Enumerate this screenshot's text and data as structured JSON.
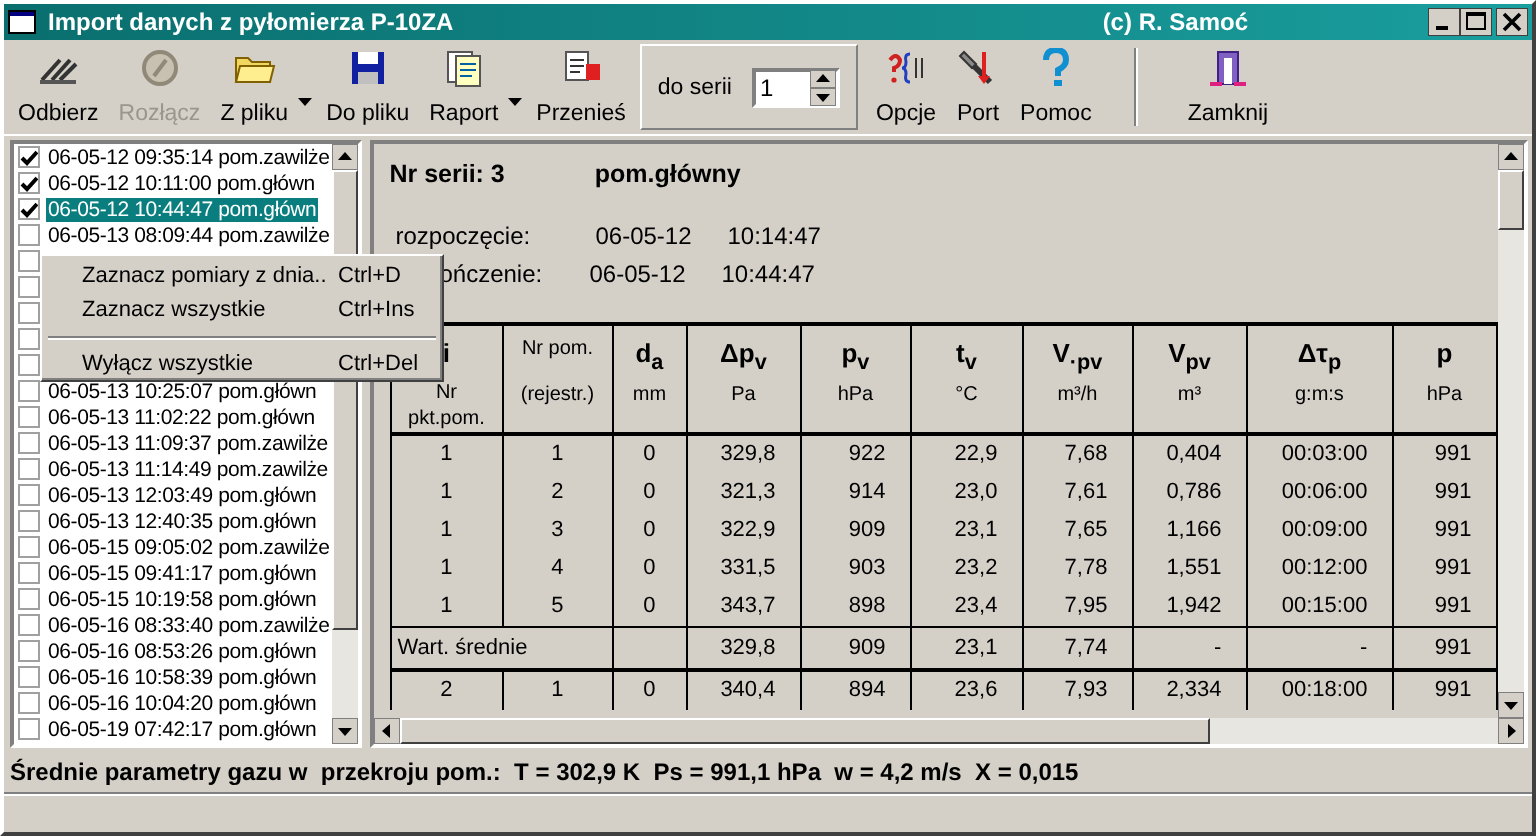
{
  "window": {
    "title": "Import danych z pyłomierza P-10ZA",
    "author": "(c) R. Samoć"
  },
  "toolbar": [
    {
      "label": "Odbierz",
      "disabled": false,
      "dropdown": false
    },
    {
      "label": "Rozłącz",
      "disabled": true,
      "dropdown": false
    },
    {
      "label": "Z pliku",
      "disabled": false,
      "dropdown": true
    },
    {
      "label": "Do pliku",
      "disabled": false,
      "dropdown": false
    },
    {
      "label": "Raport",
      "disabled": false,
      "dropdown": true
    },
    {
      "label": "Przenieś",
      "disabled": false,
      "dropdown": false
    }
  ],
  "series_selector": {
    "label": "do serii",
    "value": "1"
  },
  "toolbar_right": [
    {
      "label": "Opcje"
    },
    {
      "label": "Port"
    },
    {
      "label": "Pomoc"
    }
  ],
  "close_button": {
    "label": "Zamknij"
  },
  "measurements": [
    {
      "text": "06-05-12 09:35:14 pom.zawilże",
      "checked": true,
      "selected": false
    },
    {
      "text": "06-05-12 10:11:00 pom.główn",
      "checked": true,
      "selected": false
    },
    {
      "text": "06-05-12 10:44:47 pom.główn",
      "checked": true,
      "selected": true
    },
    {
      "text": "06-05-13 08:09:44 pom.zawilże",
      "checked": false,
      "selected": false
    },
    {
      "checked": false
    },
    {
      "checked": false
    },
    {
      "checked": false
    },
    {
      "checked": false
    },
    {
      "checked": false
    },
    {
      "text": "06-05-13 10:25:07 pom.główn",
      "checked": false,
      "selected": false
    },
    {
      "text": "06-05-13 11:02:22 pom.główn",
      "checked": false,
      "selected": false
    },
    {
      "text": "06-05-13 11:09:37 pom.zawilże",
      "checked": false,
      "selected": false
    },
    {
      "text": "06-05-13 11:14:49 pom.zawilże",
      "checked": false,
      "selected": false
    },
    {
      "text": "06-05-13 12:03:49 pom.główn",
      "checked": false,
      "selected": false
    },
    {
      "text": "06-05-13 12:40:35 pom.główn",
      "checked": false,
      "selected": false
    },
    {
      "text": "06-05-15 09:05:02 pom.zawilże",
      "checked": false,
      "selected": false
    },
    {
      "text": "06-05-15 09:41:17 pom.główn",
      "checked": false,
      "selected": false
    },
    {
      "text": "06-05-15 10:19:58 pom.główn",
      "checked": false,
      "selected": false
    },
    {
      "text": "06-05-16 08:33:40 pom.zawilże",
      "checked": false,
      "selected": false
    },
    {
      "text": "06-05-16 08:53:26 pom.główn",
      "checked": false,
      "selected": false
    },
    {
      "text": "06-05-16 10:58:39 pom.główn",
      "checked": false,
      "selected": false
    },
    {
      "text": "06-05-16 10:04:20 pom.główn",
      "checked": false,
      "selected": false
    },
    {
      "text": "06-05-19 07:42:17 pom.główn",
      "checked": false,
      "selected": false
    }
  ],
  "context_menu": [
    {
      "kind": "item",
      "label": "Zaznacz pomiary z dnia..",
      "shortcut": "Ctrl+D"
    },
    {
      "kind": "item",
      "label": "Zaznacz wszystkie",
      "shortcut": "Ctrl+Ins"
    },
    {
      "kind": "separator"
    },
    {
      "kind": "item",
      "label": "Wyłącz wszystkie",
      "shortcut": "Ctrl+Del"
    }
  ],
  "series": {
    "number": "Nr serii: 3",
    "place": "pom.główny",
    "start_label": "rozpoczęcie:",
    "start_date": "06-05-12",
    "start_time": "10:14:47",
    "end_label": "ończenie:",
    "end_date": "06-05-12",
    "end_time": "10:44:47"
  },
  "table": {
    "columns": [
      {
        "symbol": "i",
        "unit": "Nr pkt.pom."
      },
      {
        "symbol": "Nr pom.",
        "unit": "(rejestr.)",
        "kind": "plain"
      },
      {
        "symbol": "d$_{a}$",
        "unit": "mm"
      },
      {
        "symbol": "Δp$_{v}$",
        "unit": "Pa"
      },
      {
        "symbol": "p$_{v}$",
        "unit": "hPa"
      },
      {
        "symbol": "t$_{v}$",
        "unit": "°C"
      },
      {
        "symbol": "V$_{·pv}$",
        "unit": "m³/h"
      },
      {
        "symbol": "V$_{pv}$",
        "unit": "m³"
      },
      {
        "symbol": "Δτ$_{p}$",
        "unit": "g:m:s"
      },
      {
        "symbol": "p",
        "unit": "hPa"
      }
    ],
    "rows": [
      {
        "kind": "data",
        "cells": [
          "1",
          "1",
          "0",
          "329,8",
          "922",
          "22,9",
          "7,68",
          "0,404",
          "00:03:00",
          "991"
        ]
      },
      {
        "kind": "data",
        "cells": [
          "1",
          "2",
          "0",
          "321,3",
          "914",
          "23,0",
          "7,61",
          "0,786",
          "00:06:00",
          "991"
        ]
      },
      {
        "kind": "data",
        "cells": [
          "1",
          "3",
          "0",
          "322,9",
          "909",
          "23,1",
          "7,65",
          "1,166",
          "00:09:00",
          "991"
        ]
      },
      {
        "kind": "data",
        "cells": [
          "1",
          "4",
          "0",
          "331,5",
          "903",
          "23,2",
          "7,78",
          "1,551",
          "00:12:00",
          "991"
        ]
      },
      {
        "kind": "data",
        "cells": [
          "1",
          "5",
          "0",
          "343,7",
          "898",
          "23,4",
          "7,95",
          "1,942",
          "00:15:00",
          "991"
        ]
      },
      {
        "kind": "average",
        "cells": [
          "Wart. średnie",
          "",
          "",
          "329,8",
          "909",
          "23,1",
          "7,74",
          "-",
          "-",
          "991"
        ]
      },
      {
        "kind": "data",
        "cells": [
          "2",
          "1",
          "0",
          "340,4",
          "894",
          "23,6",
          "7,93",
          "2,334",
          "00:18:00",
          "991"
        ]
      }
    ]
  },
  "status_bar": "Średnie parametry gazu w  przekroju pom.:  T = 302,9 K  Ps = 991,1 hPa  w = 4,2 m/s  X = 0,015"
}
